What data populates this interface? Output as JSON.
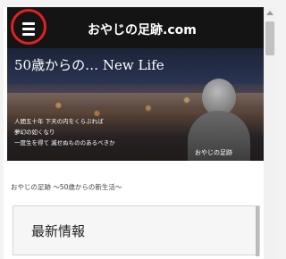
{
  "header": {
    "title": "おやじの足跡.com",
    "menu_icon": "hamburger-menu-icon",
    "highlight_color": "#e02020"
  },
  "hero": {
    "title": "50歳からの… New Life",
    "lines": [
      "人間五十年 下天の内をくらぶれば",
      "夢幻の如くなり",
      "一度生を得て 滅せぬもののあるべきか"
    ],
    "caption": "おやじの足跡"
  },
  "breadcrumb": "おやじの足跡 〜50歳からの新生活〜",
  "section": {
    "title": "最新情報"
  }
}
